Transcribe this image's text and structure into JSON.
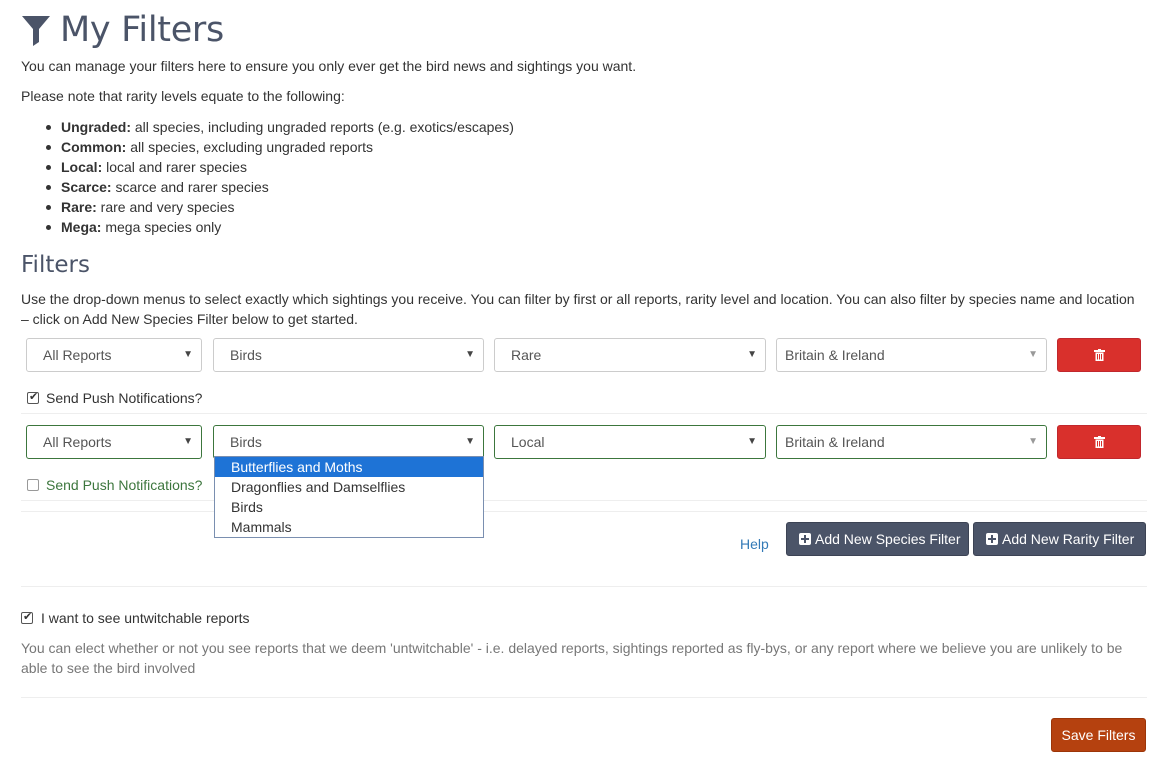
{
  "header": {
    "title": "My Filters",
    "intro": "You can manage your filters here to ensure you only ever get the bird news and sightings you want.",
    "note": "Please note that rarity levels equate to the following:"
  },
  "levels": [
    {
      "name": "Ungraded:",
      "desc": " all species, including ungraded reports (e.g. exotics/escapes)"
    },
    {
      "name": "Common:",
      "desc": " all species, excluding ungraded reports"
    },
    {
      "name": "Local:",
      "desc": " local and rarer species"
    },
    {
      "name": "Scarce:",
      "desc": " scarce and rarer species"
    },
    {
      "name": "Rare:",
      "desc": " rare and very species"
    },
    {
      "name": "Mega:",
      "desc": " mega species only"
    }
  ],
  "filters_section": {
    "heading": "Filters",
    "description": "Use the drop-down menus to select exactly which sightings you receive. You can filter by first or all reports, rarity level and location. You can also filter by species name and location – click on Add New Species Filter below to get started."
  },
  "filter_rows": [
    {
      "reports": "All Reports",
      "group": "Birds",
      "rarity": "Rare",
      "location": "Britain & Ireland",
      "push_label": "Send Push Notifications?",
      "push_checked": true
    },
    {
      "reports": "All Reports",
      "group": "Birds",
      "rarity": "Local",
      "location": "Britain & Ireland",
      "push_label": "Send Push Notifications?",
      "push_checked": false
    }
  ],
  "group_dropdown": {
    "options": [
      "Butterflies and Moths",
      "Dragonflies and Damselflies",
      "Birds",
      "Mammals"
    ],
    "highlighted": "Butterflies and Moths"
  },
  "actions": {
    "help": "Help",
    "add_species": "Add New Species Filter",
    "add_rarity": "Add New Rarity Filter"
  },
  "untwitchable": {
    "label": "I want to see untwitchable reports",
    "checked": true,
    "description": "You can elect whether or not you see reports that we deem 'untwitchable' - i.e. delayed reports, sightings reported as fly-bys, or any report where we believe you are unlikely to be able to see the bird involved"
  },
  "save_label": "Save Filters",
  "icons": {
    "title": "filter-icon",
    "delete": "trash-icon",
    "add": "plus-square-icon",
    "caret": "caret-down-icon"
  },
  "colors": {
    "heading": "#4b5468",
    "danger": "#d9302c",
    "dark_button": "#4b5468",
    "save_button": "#b5410f",
    "valid_border": "#3c763d",
    "link": "#337ab7",
    "highlight": "#1e73d6"
  }
}
